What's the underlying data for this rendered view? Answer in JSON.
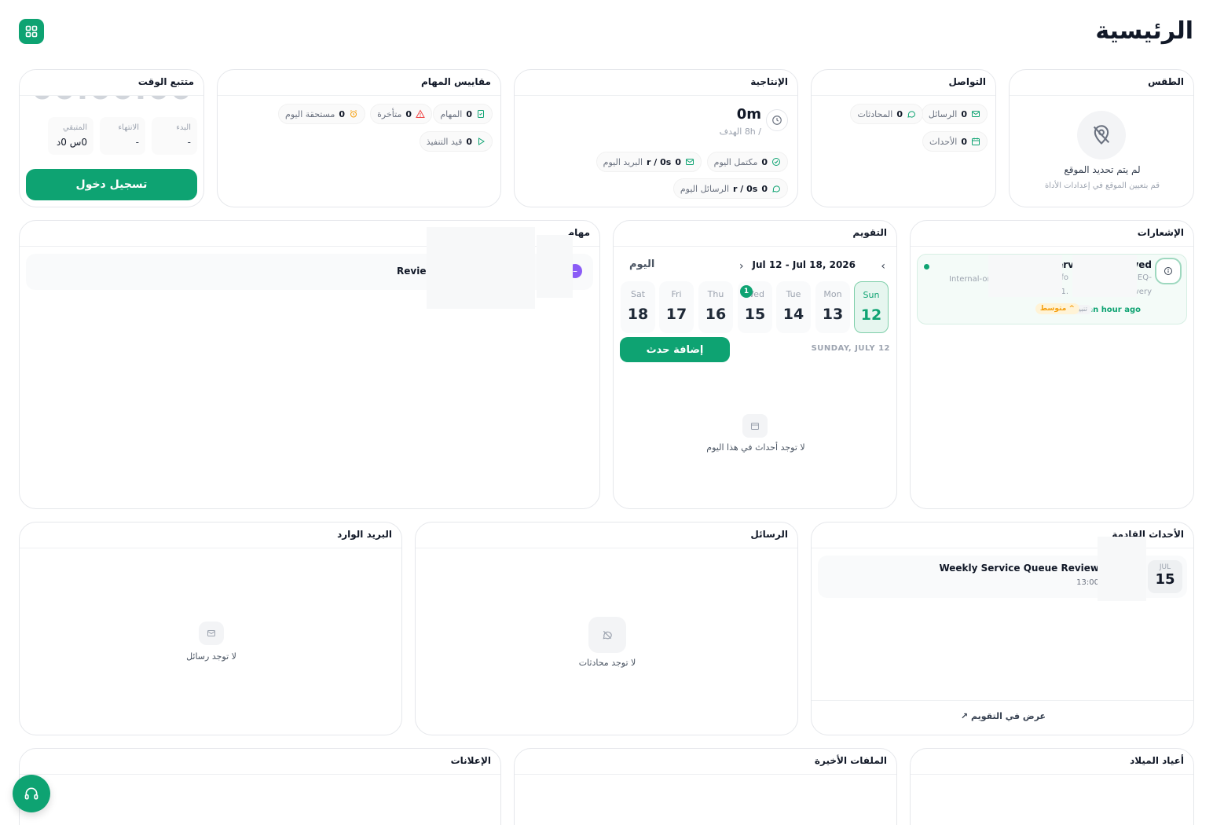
{
  "page": {
    "title": "الرئيسية"
  },
  "weather": {
    "title": "الطقس",
    "no_location": "لم يتم تحديد الموقع",
    "hint": "قم بتعيين الموقع في إعدادات الأداة"
  },
  "communication": {
    "title": "التواصل",
    "messages_count": "0",
    "messages_label": "الرسائل",
    "conversations_count": "0",
    "conversations_label": "المحادثات",
    "events_count": "0",
    "events_label": "الأحداث"
  },
  "productivity": {
    "title": "الإنتاجية",
    "value": "0m",
    "goal": "/ 8h الهدف",
    "completed_count": "0",
    "completed_label": "مكتمل اليوم",
    "email_count": "0",
    "email_rate": "r / 0s",
    "email_label": "البريد اليوم",
    "messages_count": "0",
    "messages_rate": "r / 0s",
    "messages_label": "الرسائل اليوم"
  },
  "task_metrics": {
    "title": "مقاييس المهام",
    "tasks_count": "0",
    "tasks_label": "المهام",
    "overdue_count": "0",
    "overdue_label": "متأخرة",
    "due_today_count": "0",
    "due_today_label": "مستحقة اليوم",
    "in_progress_count": "0",
    "in_progress_label": "قيد التنفيذ"
  },
  "time_tracker": {
    "title": "متتبع الوقت",
    "clock": "00:00:00",
    "start_label": "البدء",
    "start_value": "-",
    "end_label": "الانتهاء",
    "end_value": "-",
    "remaining_label": "المتبقي",
    "remaining_value": "0س 0د",
    "login_button": "تسجيل دخول"
  },
  "notifications": {
    "title": "الإشعارات",
    "item_title_a": "erv",
    "item_title_b": "ved",
    "item_line_a": "Internal-or",
    "item_line_b": ": fo",
    "item_line_c": "EQ-",
    "item_line_d": "01.",
    "item_line_e": "very",
    "priority": "متوسط",
    "tag": "تنبيه",
    "time": "an hour ago"
  },
  "calendar": {
    "title": "التقويم",
    "range": "Jul 12 - Jul 18, 2026",
    "today_button": "اليوم",
    "days": [
      {
        "name": "Sun",
        "date": "12"
      },
      {
        "name": "Mon",
        "date": "13"
      },
      {
        "name": "Tue",
        "date": "14"
      },
      {
        "name": "Wed",
        "date": "15",
        "badge": "1"
      },
      {
        "name": "Thu",
        "date": "16"
      },
      {
        "name": "Fri",
        "date": "17"
      },
      {
        "name": "Sat",
        "date": "18"
      }
    ],
    "selected_heading": "SUNDAY, JULY 12",
    "add_event_button": "إضافة حدث",
    "empty_text": "لا توجد أحداث في هذا اليوم"
  },
  "tasks": {
    "title": "مهام",
    "item_text": "Review"
  },
  "upcoming_events": {
    "title": "الأحداث القادمة",
    "event_title": "Weekly Service Queue Review",
    "event_time": "13:00",
    "event_month": "JUL",
    "event_day": "15",
    "view_link": "عرض في التقويم"
  },
  "messages_widget": {
    "title": "الرسائل",
    "empty_text": "لا توجد محادثات"
  },
  "inbox": {
    "title": "البريد الوارد",
    "empty_text": "لا توجد رسائل"
  },
  "birthdays": {
    "title": "أعياد الميلاد"
  },
  "recent_files": {
    "title": "الملفات الأخيرة"
  },
  "announcements": {
    "title": "الإعلانات"
  },
  "colors": {
    "accent": "#0ea372",
    "danger": "#ef4444",
    "warning": "#f59e0b",
    "purple": "#8b5cf6"
  },
  "icons": [
    "apps-grid-icon",
    "location-off-icon",
    "mail-icon",
    "chat-icon",
    "calendar-icon",
    "clock-icon",
    "check-circle-icon",
    "task-icon",
    "alert-triangle-icon",
    "alarm-icon",
    "play-icon",
    "info-icon",
    "chevron-left-icon",
    "chevron-right-icon",
    "external-link-icon",
    "headset-icon",
    "mail-off-icon",
    "chat-off-icon"
  ]
}
